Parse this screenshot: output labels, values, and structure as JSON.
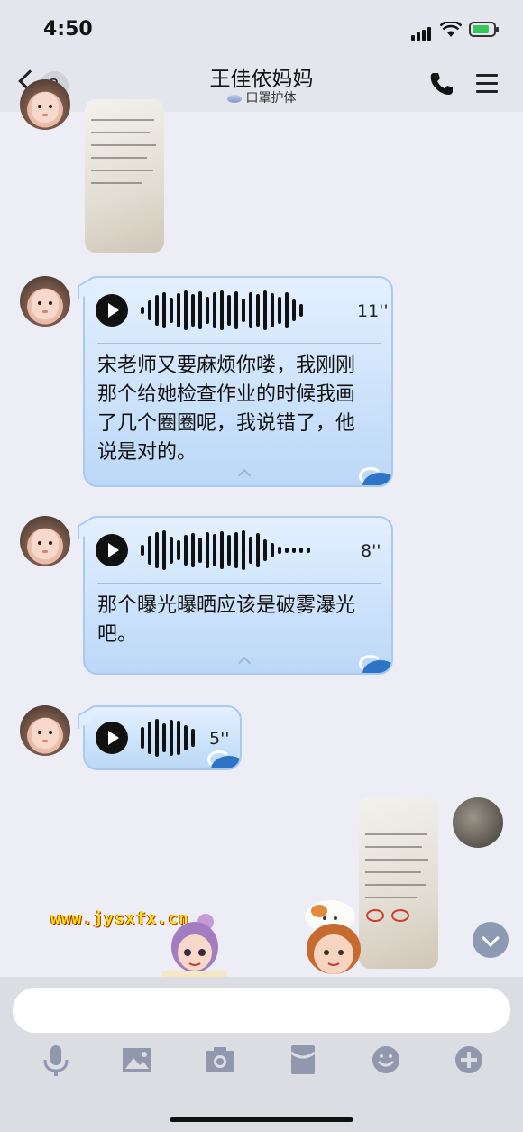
{
  "status_bar": {
    "time": "4:50"
  },
  "header": {
    "back_badge": "2",
    "title": "王佳依妈妈",
    "subtitle": "口罩护体"
  },
  "messages": [
    {
      "type": "image",
      "from": "other"
    },
    {
      "type": "voice",
      "from": "other",
      "duration": "11''",
      "transcript": [
        "宋老师又要麻烦你喽，我刚刚",
        "那个给她检查作业的时候我画",
        "了几个圈圈呢，我说错了，他",
        "说是对的。"
      ]
    },
    {
      "type": "voice",
      "from": "other",
      "duration": "8''",
      "transcript": [
        "那个曝光曝晒应该是破雾瀑光",
        "吧。"
      ]
    },
    {
      "type": "voice",
      "from": "other",
      "duration": "5''"
    },
    {
      "type": "image",
      "from": "me"
    }
  ],
  "watermark": "www.jysxfx.cn",
  "toolbar": [
    "mic-icon",
    "image-icon",
    "camera-icon",
    "red-packet-icon",
    "emoji-icon",
    "plus-icon"
  ],
  "colors": {
    "bubble": "#cfe4fb",
    "bubble_border": "#a9c9ef",
    "background": "#ecedf5"
  }
}
